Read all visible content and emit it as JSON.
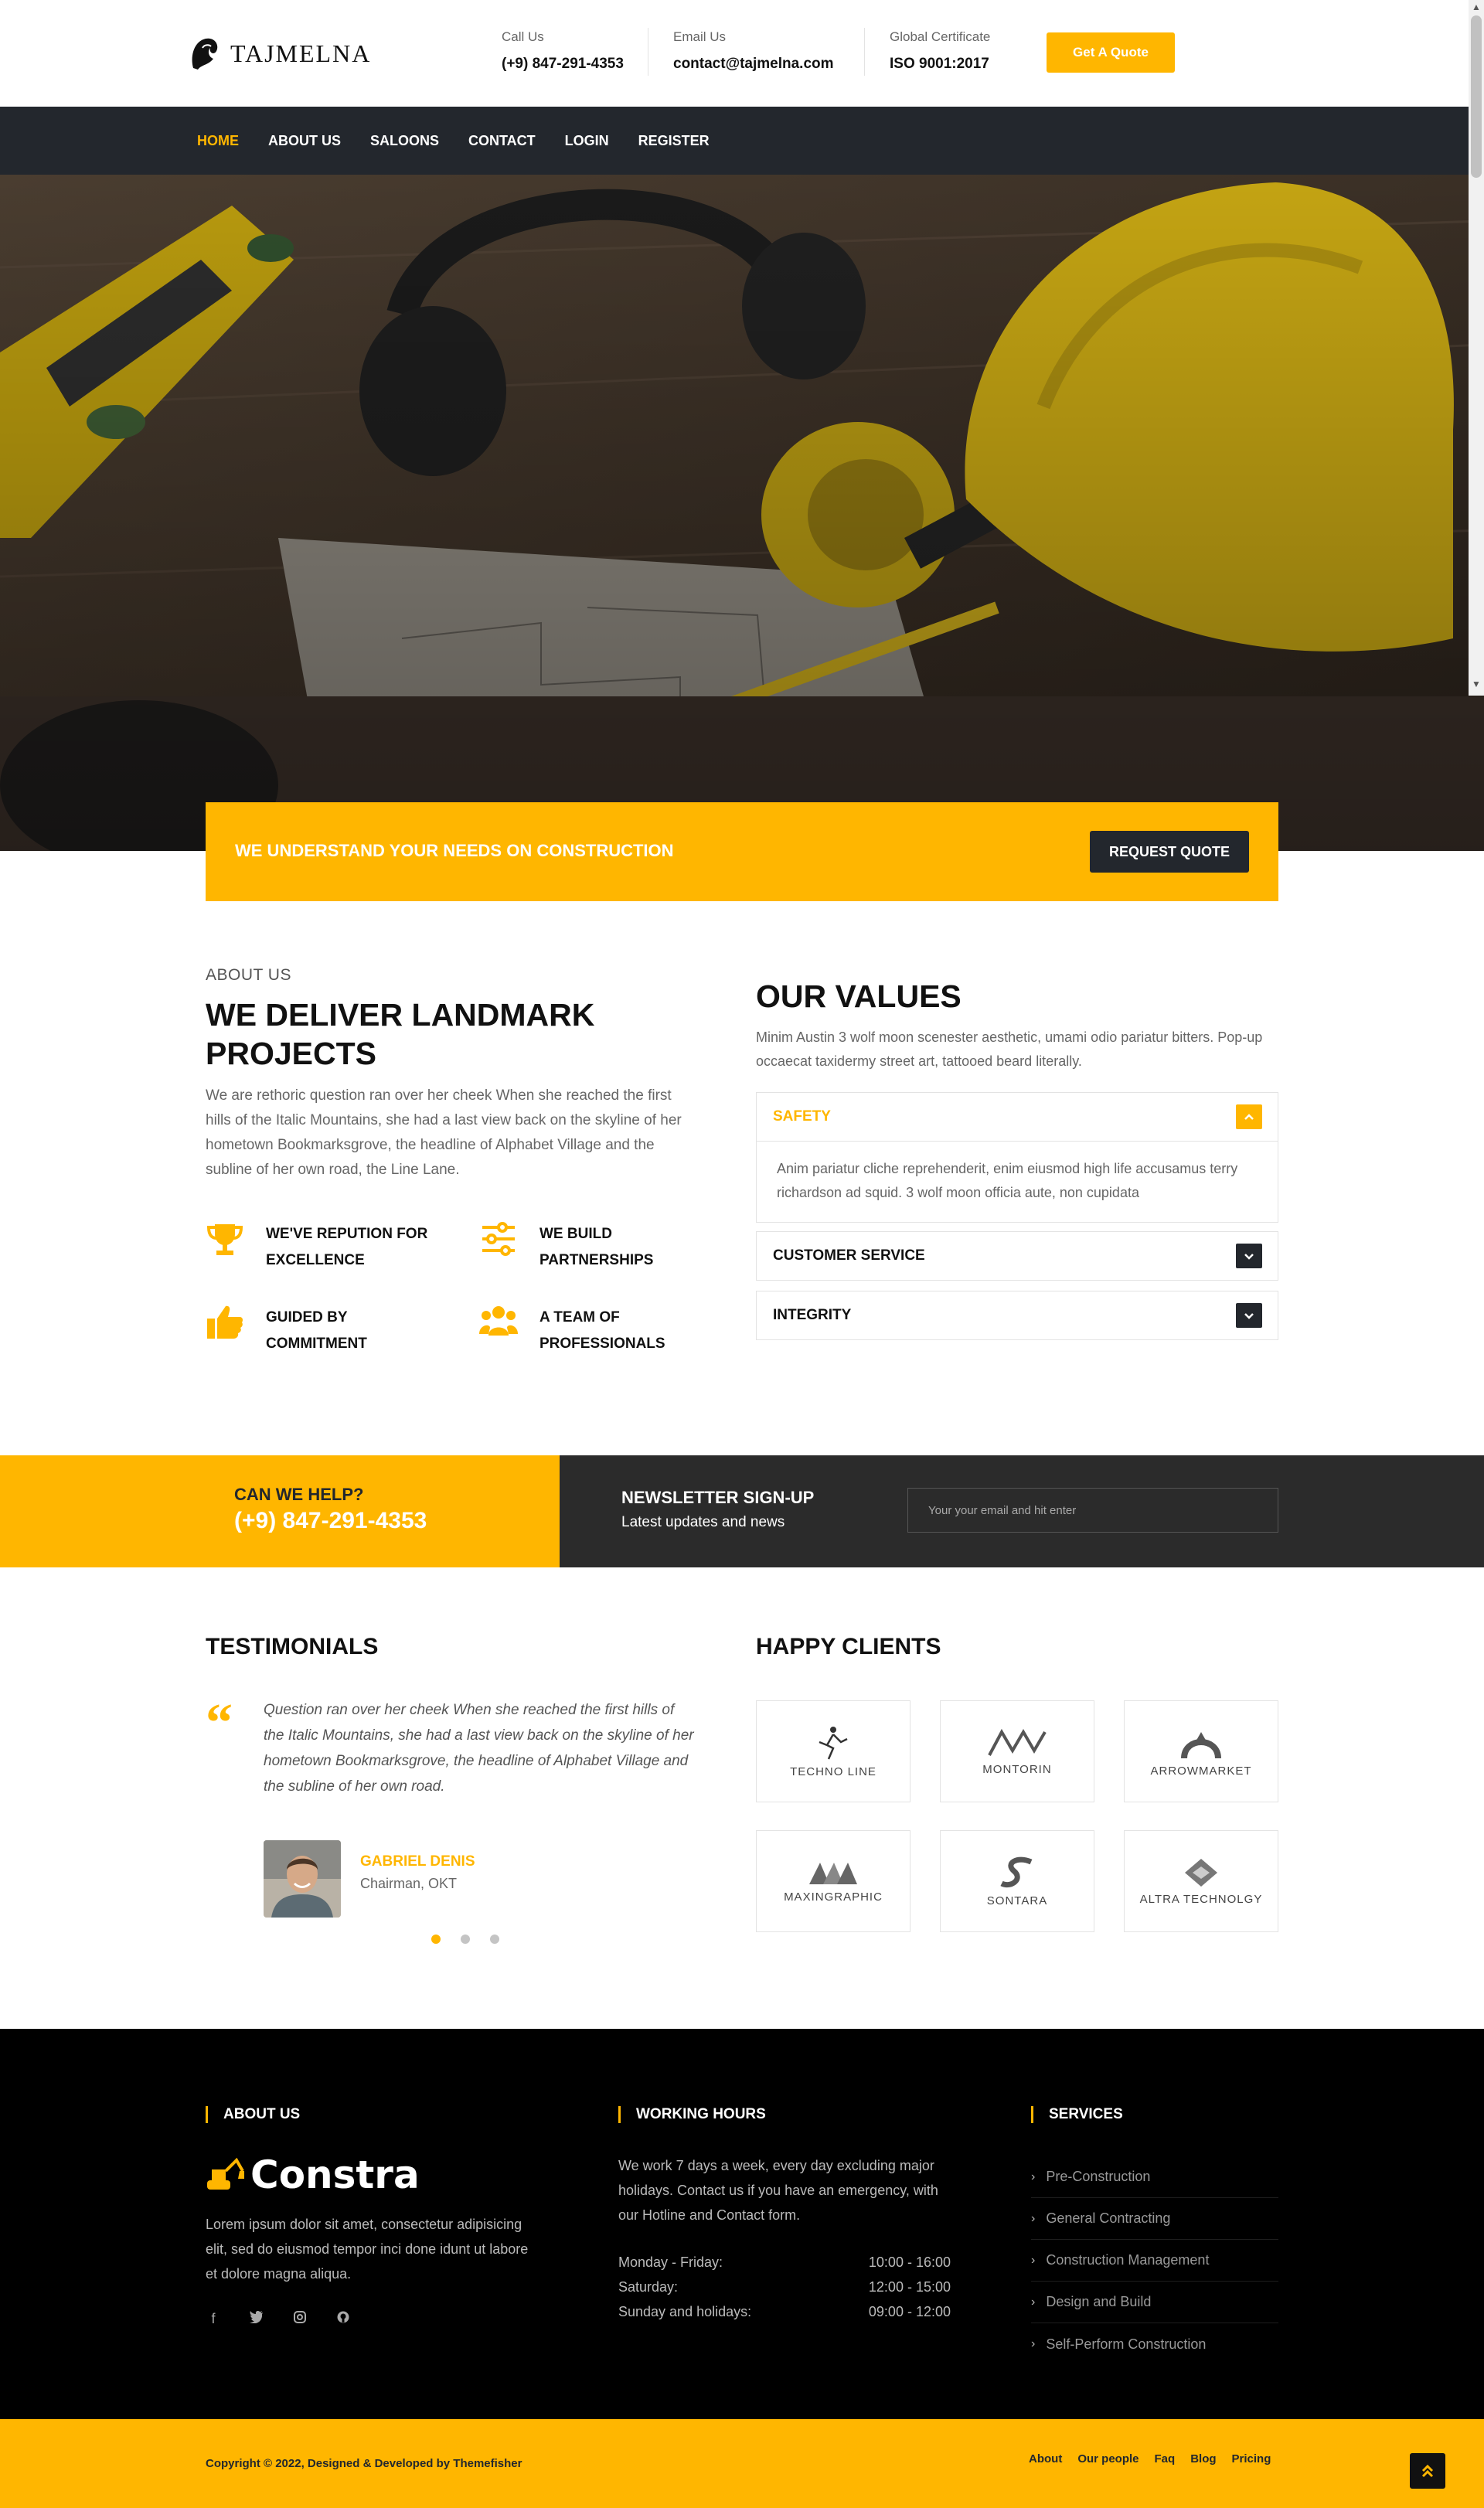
{
  "header": {
    "brand": "TAJMELNA",
    "call": {
      "label": "Call Us",
      "value": "(+9) 847-291-4353"
    },
    "email": {
      "label": "Email Us",
      "value": "contact@tajmelna.com"
    },
    "cert": {
      "label": "Global Certificate",
      "value": "ISO 9001:2017"
    },
    "quote_button": "Get A Quote"
  },
  "nav": {
    "items": [
      "HOME",
      "ABOUT US",
      "SALOONS",
      "CONTACT",
      "LOGIN",
      "REGISTER"
    ],
    "active": "HOME"
  },
  "cta": {
    "text": "WE UNDERSTAND YOUR NEEDS ON CONSTRUCTION",
    "button": "REQUEST QUOTE"
  },
  "about": {
    "kicker": "ABOUT US",
    "title": "WE DELIVER LANDMARK PROJECTS",
    "body": "We are rethoric question ran over her cheek When she reached the first hills of the Italic Mountains, she had a last view back on the skyline of her hometown Bookmarksgrove, the headline of Alphabet Village and the subline of her own road, the Line Lane.",
    "features": [
      {
        "icon": "trophy-icon",
        "text": "WE'VE REPUTION FOR EXCELLENCE"
      },
      {
        "icon": "sliders-icon",
        "text": "WE BUILD PARTNERSHIPS"
      },
      {
        "icon": "thumbs-up-icon",
        "text": "GUIDED BY COMMITMENT"
      },
      {
        "icon": "users-icon",
        "text": "A TEAM OF PROFESSIONALS"
      }
    ]
  },
  "values": {
    "title": "OUR VALUES",
    "body": "Minim Austin 3 wolf moon scenester aesthetic, umami odio pariatur bitters. Pop-up occaecat taxidermy street art, tattooed beard literally.",
    "accordion": [
      {
        "title": "SAFETY",
        "open": true,
        "body": "Anim pariatur cliche reprehenderit, enim eiusmod high life accusamus terry richardson ad squid. 3 wolf moon officia aute, non cupidata"
      },
      {
        "title": "CUSTOMER SERVICE",
        "open": false
      },
      {
        "title": "INTEGRITY",
        "open": false
      }
    ]
  },
  "help": {
    "question": "CAN WE HELP?",
    "phone": "(+9) 847-291-4353"
  },
  "newsletter": {
    "title": "NEWSLETTER SIGN-UP",
    "subtitle": "Latest updates and news",
    "placeholder": "Your your email and hit enter"
  },
  "testimonials": {
    "title": "TESTIMONIALS",
    "quote": "Question ran over her cheek When she reached the first hills of the Italic Mountains, she had a last view back on the skyline of her hometown Bookmarksgrove, the headline of Alphabet Village and the subline of her own road.",
    "name": "GABRIEL DENIS",
    "role": "Chairman, OKT",
    "active_slide": 1
  },
  "clients": {
    "title": "HAPPY CLIENTS",
    "logos": [
      "TECHNO LINE",
      "MONTORIN",
      "ARROWMARKET",
      "MAXINGRAPHIC",
      "SONTARA",
      "ALTRA TECHNOLGY"
    ]
  },
  "footer": {
    "about_title": "ABOUT US",
    "logo_text": "Constra",
    "about_text": "Lorem ipsum dolor sit amet, consectetur adipisicing elit, sed do eiusmod tempor inci done idunt ut labore et dolore magna aliqua.",
    "socials": [
      "facebook-icon",
      "twitter-icon",
      "instagram-icon",
      "github-icon"
    ],
    "hours_title": "WORKING HOURS",
    "hours_text": "We work 7 days a week, every day excluding major holidays. Contact us if you have an emergency, with our Hotline and Contact form.",
    "hours": [
      {
        "day": "Monday - Friday:",
        "time": "10:00 - 16:00"
      },
      {
        "day": "Saturday:",
        "time": "12:00 - 15:00"
      },
      {
        "day": "Sunday and holidays:",
        "time": "09:00 - 12:00"
      }
    ],
    "services_title": "SERVICES",
    "services": [
      "Pre-Construction",
      "General Contracting",
      "Construction Management",
      "Design and Build",
      "Self-Perform Construction"
    ]
  },
  "copyright": {
    "text": "Copyright © 2022, Designed & Developed by Themefisher",
    "links": [
      "About",
      "Our people",
      "Faq",
      "Blog",
      "Pricing"
    ]
  },
  "colors": {
    "accent": "#ffb600",
    "dark": "#23272d",
    "footer": "#000000"
  }
}
